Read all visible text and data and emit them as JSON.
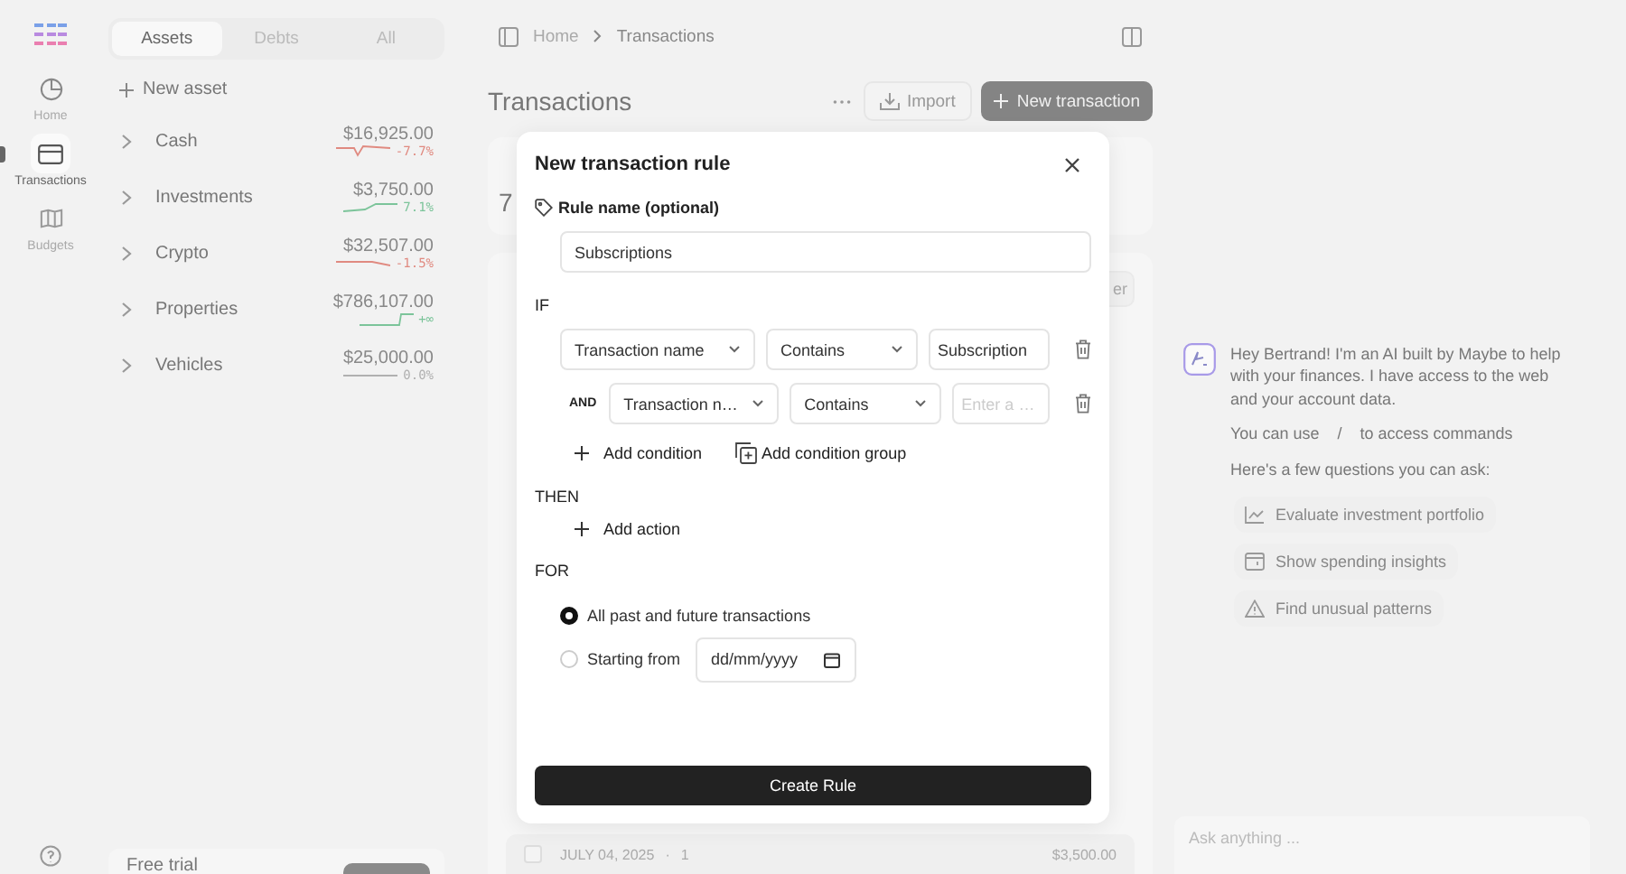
{
  "app_rail": {
    "items": [
      {
        "label": "Home",
        "selected": false
      },
      {
        "label": "Transactions",
        "selected": true
      },
      {
        "label": "Budgets",
        "selected": false
      }
    ]
  },
  "accounts_panel": {
    "tabs": [
      {
        "label": "Assets",
        "selected": true
      },
      {
        "label": "Debts",
        "selected": false
      },
      {
        "label": "All",
        "selected": false
      }
    ],
    "new_button": "New asset",
    "groups": [
      {
        "name": "Cash",
        "balance": "$16,925.00",
        "change": "-7.7%",
        "color": "#e08a80"
      },
      {
        "name": "Investments",
        "balance": "$3,750.00",
        "change": "7.1%",
        "color": "#7cc49a"
      },
      {
        "name": "Crypto",
        "balance": "$32,507.00",
        "change": "-1.5%",
        "color": "#e08a80"
      },
      {
        "name": "Properties",
        "balance": "$786,107.00",
        "change": "+∞",
        "color": "#7cc49a"
      },
      {
        "name": "Vehicles",
        "balance": "$25,000.00",
        "change": "0.0%",
        "color": "#b0b0b0"
      }
    ],
    "trial": {
      "label": "Free trial"
    }
  },
  "breadcrumb": [
    "Home",
    "Transactions"
  ],
  "page": {
    "title": "Transactions",
    "import_button": "Import",
    "new_button": "New transaction"
  },
  "background": {
    "summary_value": "7",
    "filter_fragment": "er",
    "rows": [
      {
        "checked": false,
        "date": "JULY 04, 2025",
        "separator": "·",
        "count": "1",
        "amount": "$3,500.00"
      }
    ]
  },
  "modal": {
    "title": "New transaction rule",
    "name_label": "Rule name (optional)",
    "name_value": "Subscriptions",
    "if_label": "IF",
    "conditions": [
      {
        "field": "Transaction name",
        "match": "Contains",
        "value": "Subscription"
      },
      {
        "operator": "AND",
        "field": "Transaction n…",
        "match": "Contains",
        "placeholder": "Enter a …"
      }
    ],
    "add_condition": "Add condition",
    "add_group": "Add condition group",
    "then_label": "THEN",
    "add_action": "Add action",
    "for_label": "FOR",
    "scope": [
      {
        "label": "All past and future transactions",
        "selected": true
      },
      {
        "label": "Starting from",
        "selected": false,
        "date_placeholder": "dd/mm/yyyy"
      }
    ],
    "submit": "Create Rule"
  },
  "chat": {
    "greeting": "Hey Bertrand! I'm an AI built by Maybe to help with your finances. I have access to the web and your account data.",
    "commands_before": "You can use",
    "commands_key": "/",
    "commands_after": "to access commands",
    "prompt": "Here's a few questions you can ask:",
    "suggestions": [
      "Evaluate investment portfolio",
      "Show spending insights",
      "Find unusual patterns"
    ],
    "input_placeholder": "Ask anything ..."
  }
}
